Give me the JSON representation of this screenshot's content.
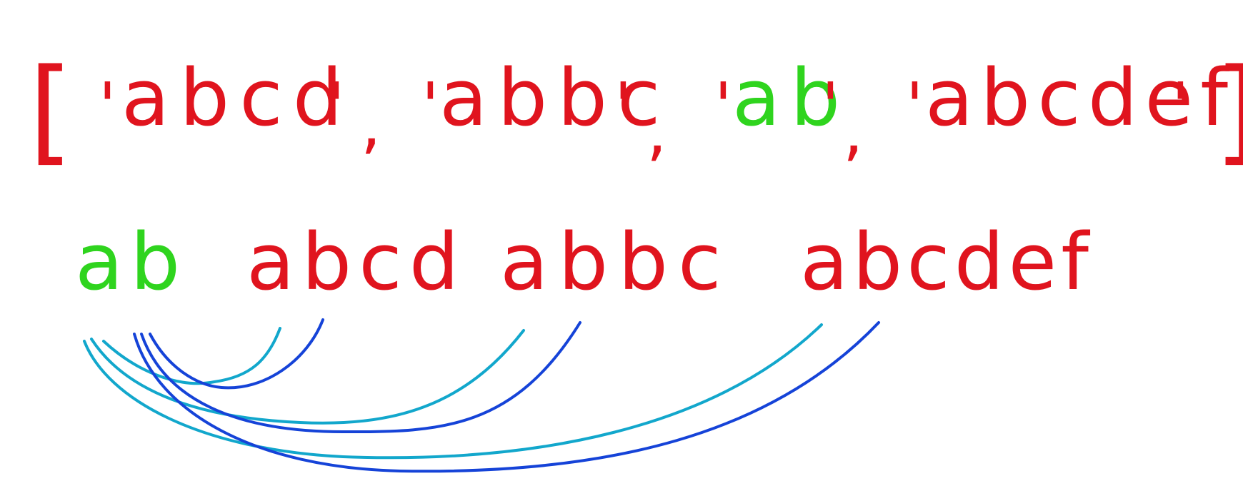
{
  "colors": {
    "red": "#e0141e",
    "green": "#2fd41e",
    "cyan": "#12a7cc",
    "blue": "#1543d8",
    "background": "#ffffff"
  },
  "top_array": {
    "open_bracket": "[",
    "close_bracket": "]",
    "separator": ",",
    "quote": "'",
    "items": [
      {
        "text": "abcd",
        "highlight": ""
      },
      {
        "text": "abbc",
        "highlight": ""
      },
      {
        "text": "ab",
        "highlight": "ab"
      },
      {
        "text": "abcdef",
        "highlight": ""
      }
    ]
  },
  "sorted_words": [
    {
      "text": "ab",
      "color": "green"
    },
    {
      "text": "abcd",
      "color": "red"
    },
    {
      "text": "abbc",
      "color": "red"
    },
    {
      "text": "abcdef",
      "color": "red"
    }
  ]
}
